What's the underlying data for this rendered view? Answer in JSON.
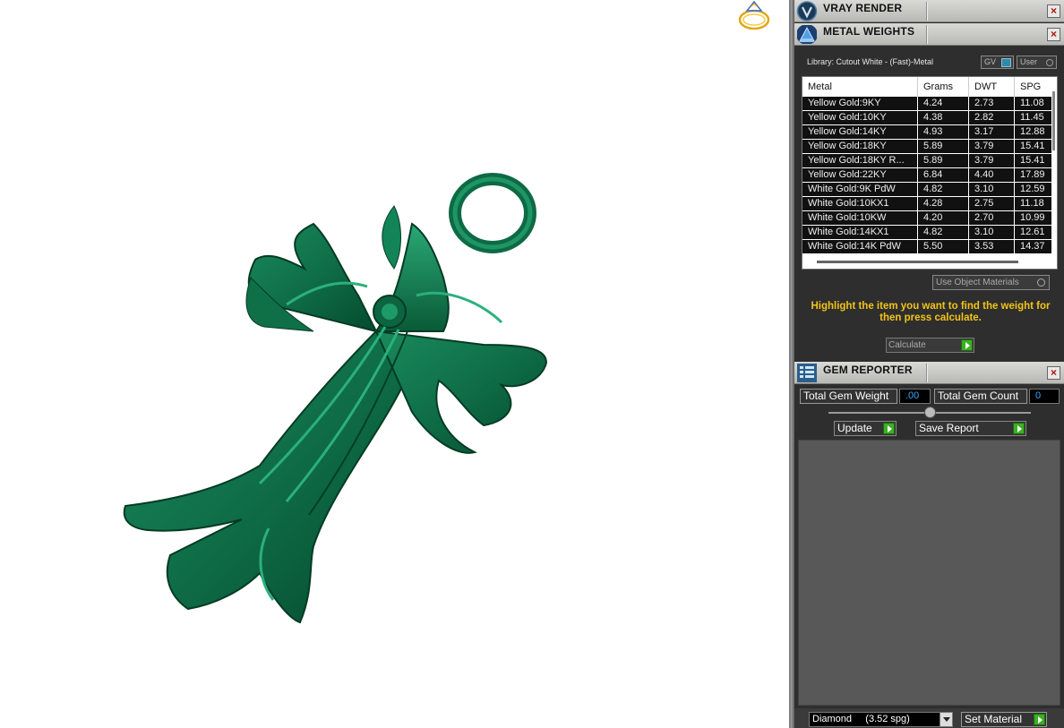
{
  "panels": {
    "vray": {
      "title": "VRAY RENDER"
    },
    "metal": {
      "title": "METAL WEIGHTS",
      "library_text": "Library: Cutout White - (Fast)-Metal",
      "gv_label": "GV",
      "user_label": "User",
      "columns": [
        "Metal",
        "Grams",
        "DWT",
        "SPG"
      ],
      "rows": [
        [
          "Yellow Gold:9KY",
          "4.24",
          "2.73",
          "11.08"
        ],
        [
          "Yellow Gold:10KY",
          "4.38",
          "2.82",
          "11.45"
        ],
        [
          "Yellow Gold:14KY",
          "4.93",
          "3.17",
          "12.88"
        ],
        [
          "Yellow Gold:18KY",
          "5.89",
          "3.79",
          "15.41"
        ],
        [
          "Yellow Gold:18KY R...",
          "5.89",
          "3.79",
          "15.41"
        ],
        [
          "Yellow Gold:22KY",
          "6.84",
          "4.40",
          "17.89"
        ],
        [
          "White Gold:9K PdW",
          "4.82",
          "3.10",
          "12.59"
        ],
        [
          "White Gold:10KX1",
          "4.28",
          "2.75",
          "11.18"
        ],
        [
          "White Gold:10KW",
          "4.20",
          "2.70",
          "10.99"
        ],
        [
          "White Gold:14KX1",
          "4.82",
          "3.10",
          "12.61"
        ],
        [
          "White Gold:14K PdW",
          "5.50",
          "3.53",
          "14.37"
        ]
      ],
      "use_object_materials": "Use Object Materials",
      "hint": "Highlight the item you want to find the weight for then press calculate.",
      "calculate_label": "Calculate"
    },
    "gem": {
      "title": "GEM REPORTER",
      "total_weight_label": "Total Gem Weight",
      "total_weight_value": ".00",
      "total_count_label": "Total Gem Count",
      "total_count_value": "0",
      "update_label": "Update",
      "save_report_label": "Save Report",
      "material_select": "Diamond     (3.52 spg)",
      "set_material_label": "Set Material"
    }
  },
  "colors": {
    "model": "#0f6e48",
    "hint": "#f2c418",
    "panel_bg": "#2e2e2e",
    "go_button": "#3bb023"
  }
}
